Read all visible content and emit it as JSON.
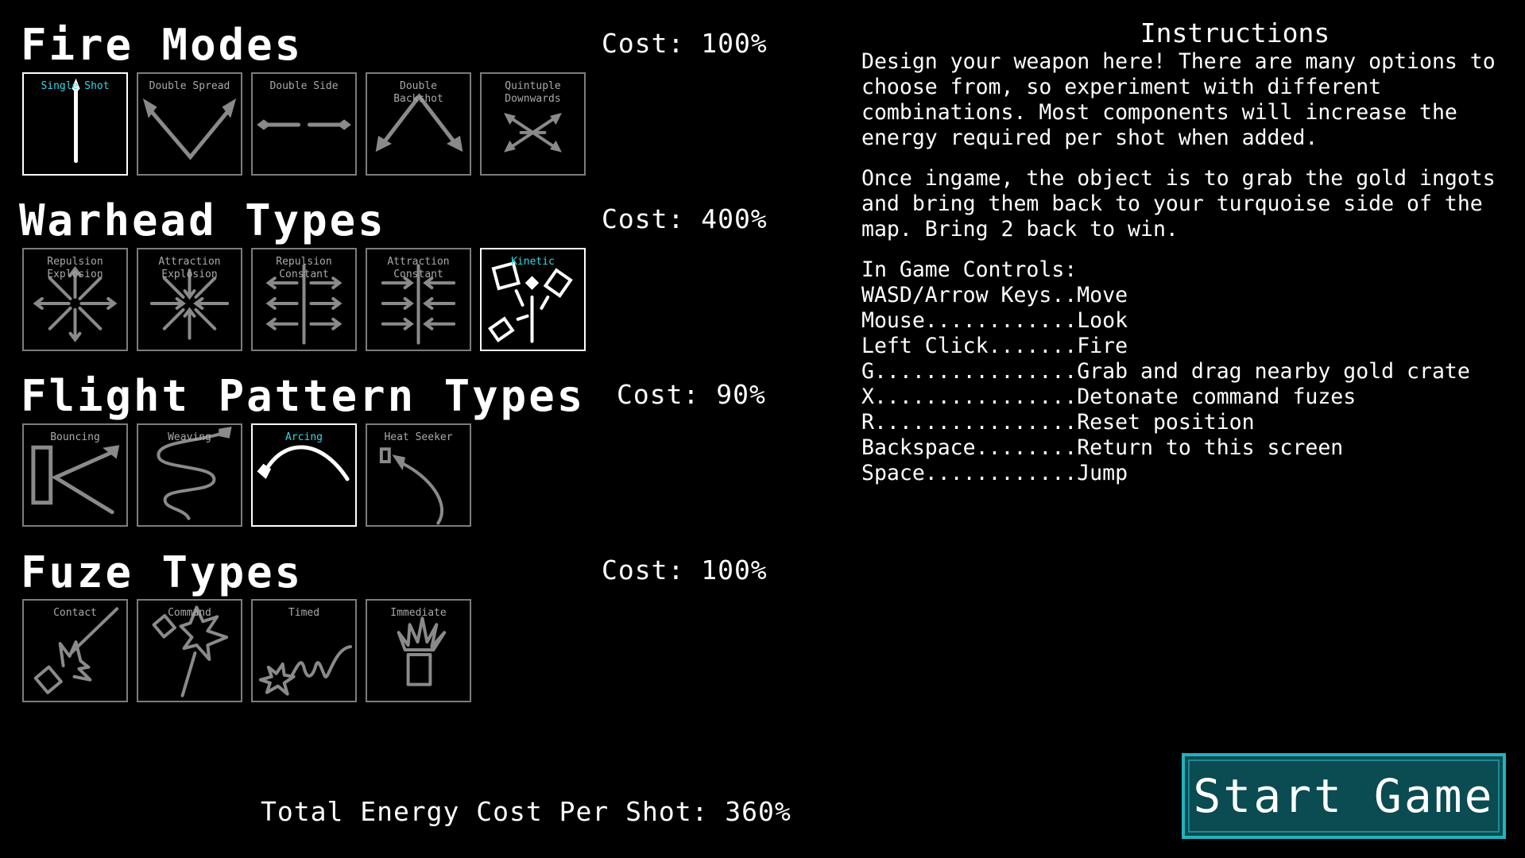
{
  "sections": {
    "fire_modes": {
      "title": "Fire Modes",
      "cost": "Cost: 100%",
      "items": [
        {
          "label": "Single Shot",
          "icon": "single-shot-icon",
          "selected": true
        },
        {
          "label": "Double Spread",
          "icon": "double-spread-icon",
          "selected": false
        },
        {
          "label": "Double Side",
          "icon": "double-side-icon",
          "selected": false
        },
        {
          "label": "Double Backshot",
          "icon": "double-backshot-icon",
          "selected": false
        },
        {
          "label": "Quintuple Downwards",
          "icon": "quintuple-downwards-icon",
          "selected": false
        }
      ]
    },
    "warhead_types": {
      "title": "Warhead Types",
      "cost": "Cost: 400%",
      "items": [
        {
          "label": "Repulsion Explosion",
          "icon": "repulsion-explosion-icon",
          "selected": false
        },
        {
          "label": "Attraction Explosion",
          "icon": "attraction-explosion-icon",
          "selected": false
        },
        {
          "label": "Repulsion Constant",
          "icon": "repulsion-constant-icon",
          "selected": false
        },
        {
          "label": "Attraction Constant",
          "icon": "attraction-constant-icon",
          "selected": false
        },
        {
          "label": "Kinetic",
          "icon": "kinetic-icon",
          "selected": true
        }
      ]
    },
    "flight_pattern_types": {
      "title": "Flight Pattern Types",
      "cost": "Cost: 90%",
      "items": [
        {
          "label": "Bouncing",
          "icon": "bouncing-icon",
          "selected": false
        },
        {
          "label": "Weaving",
          "icon": "weaving-icon",
          "selected": false
        },
        {
          "label": "Arcing",
          "icon": "arcing-icon",
          "selected": true
        },
        {
          "label": "Heat Seeker",
          "icon": "heat-seeker-icon",
          "selected": false
        }
      ]
    },
    "fuze_types": {
      "title": "Fuze Types",
      "cost": "Cost: 100%",
      "items": [
        {
          "label": "Contact",
          "icon": "contact-icon",
          "selected": false
        },
        {
          "label": "Command",
          "icon": "command-icon",
          "selected": false
        },
        {
          "label": "Timed",
          "icon": "timed-icon",
          "selected": false
        },
        {
          "label": "Immediate",
          "icon": "immediate-icon",
          "selected": false
        }
      ]
    }
  },
  "total_cost": "Total Energy Cost Per Shot: 360%",
  "instructions": {
    "title": "Instructions",
    "para1": "Design your weapon here! There are many options to choose from, so experiment with different combinations. Most components will increase the energy required per shot when added.",
    "para2": "Once ingame, the object is to grab the gold ingots and bring them back to your turquoise side of the map. Bring 2 back to win.",
    "controls_title": "In Game Controls:",
    "controls": [
      "WASD/Arrow Keys..Move",
      "Mouse............Look",
      "Left Click.......Fire",
      "G................Grab and drag nearby gold crate",
      "X................Detonate command fuzes",
      "R................Reset position",
      "Backspace........Return to this screen",
      "Space............Jump"
    ]
  },
  "start_button": "Start Game",
  "colors": {
    "background": "#000000",
    "selected_label": "#35d6e6",
    "unselected": "#7c7c7c",
    "button_fill": "#0b4b52",
    "button_border": "#21b3bd"
  }
}
